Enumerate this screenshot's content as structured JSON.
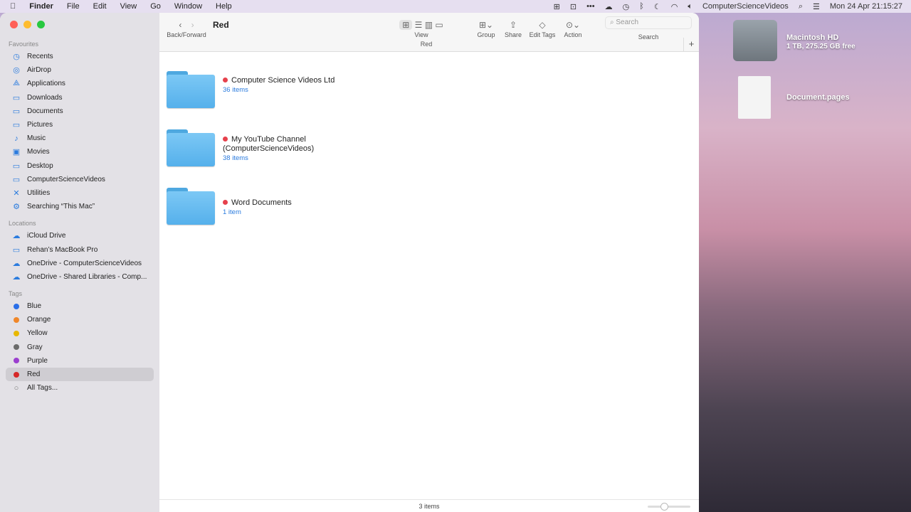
{
  "menubar": {
    "apple": "",
    "app": "Finder",
    "items": [
      "File",
      "Edit",
      "View",
      "Go",
      "Window",
      "Help"
    ],
    "user": "ComputerScienceVideos",
    "datetime": "Mon 24 Apr  21:15:27"
  },
  "toolbar": {
    "back_forward": "Back/Forward",
    "title": "Red",
    "view": "View",
    "group": "Group",
    "share": "Share",
    "edit_tags": "Edit Tags",
    "action": "Action",
    "search_placeholder": "Search",
    "search": "Search",
    "path_title": "Red",
    "add": "+"
  },
  "sidebar": {
    "favourites_label": "Favourites",
    "favourites": [
      {
        "label": "Recents",
        "icon": "clock-icon",
        "g": "◷"
      },
      {
        "label": "AirDrop",
        "icon": "airdrop-icon",
        "g": "◎"
      },
      {
        "label": "Applications",
        "icon": "applications-icon",
        "g": "⟁"
      },
      {
        "label": "Downloads",
        "icon": "folder-icon",
        "g": "▭"
      },
      {
        "label": "Documents",
        "icon": "folder-icon",
        "g": "▭"
      },
      {
        "label": "Pictures",
        "icon": "folder-icon",
        "g": "▭"
      },
      {
        "label": "Music",
        "icon": "music-icon",
        "g": "♪"
      },
      {
        "label": "Movies",
        "icon": "movies-icon",
        "g": "▣"
      },
      {
        "label": "Desktop",
        "icon": "desktop-icon",
        "g": "▭"
      },
      {
        "label": "ComputerScienceVideos",
        "icon": "folder-icon",
        "g": "▭"
      },
      {
        "label": "Utilities",
        "icon": "utilities-icon",
        "g": "✕"
      },
      {
        "label": "Searching “This Mac”",
        "icon": "gear-icon",
        "g": "⚙"
      }
    ],
    "locations_label": "Locations",
    "locations": [
      {
        "label": "iCloud Drive",
        "icon": "cloud-icon",
        "g": "☁"
      },
      {
        "label": "Rehan’s MacBook Pro",
        "icon": "laptop-icon",
        "g": "▭"
      },
      {
        "label": "OneDrive - ComputerScienceVideos",
        "icon": "cloud-icon",
        "g": "☁"
      },
      {
        "label": "OneDrive - Shared Libraries - Comp...",
        "icon": "cloud-icon",
        "g": "☁"
      }
    ],
    "tags_label": "Tags",
    "tags": [
      {
        "label": "Blue",
        "color": "#2a6ee8"
      },
      {
        "label": "Orange",
        "color": "#f0872a"
      },
      {
        "label": "Yellow",
        "color": "#e8b800"
      },
      {
        "label": "Gray",
        "color": "#6b6b6b"
      },
      {
        "label": "Purple",
        "color": "#9b3fcf"
      },
      {
        "label": "Red",
        "color": "#d62828"
      }
    ],
    "all_tags": "All Tags..."
  },
  "content": {
    "folders": [
      {
        "name": "Computer Science Videos Ltd",
        "count": "36 items"
      },
      {
        "name": "My YouTube Channel (ComputerScienceVideos)",
        "count": "38 items"
      },
      {
        "name": "Word Documents",
        "count": "1 item"
      }
    ]
  },
  "footer": {
    "status": "3 items"
  },
  "desktop": {
    "disk_name": "Macintosh HD",
    "disk_info": "1 TB, 275.25 GB free",
    "doc_name": "Document.pages"
  }
}
